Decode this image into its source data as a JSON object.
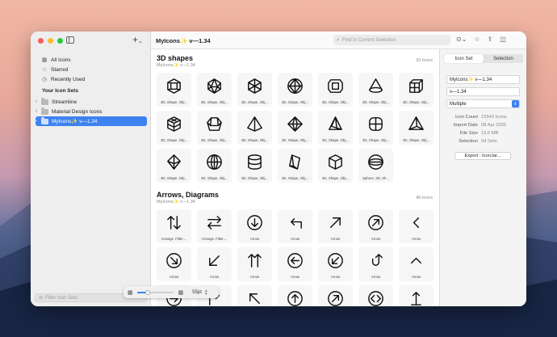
{
  "window": {
    "title": "MyIcons✨ v—1.34"
  },
  "sidebar": {
    "items": [
      {
        "label": "All Icons",
        "icon": "grid-icon"
      },
      {
        "label": "Starred",
        "icon": "star-icon"
      },
      {
        "label": "Recently Used",
        "icon": "clock-icon"
      }
    ],
    "section_label": "Your Icon Sets",
    "sets": [
      {
        "label": "Streamline",
        "selected": false
      },
      {
        "label": "Material Design Icons",
        "selected": false
      },
      {
        "label": "MyIcons✨ v—1.34",
        "selected": true
      }
    ],
    "filter_placeholder": "Filter Icon Sets"
  },
  "toolbar": {
    "search_placeholder": "Find in Current Selection"
  },
  "sections": [
    {
      "title": "3D shapes",
      "subtitle": "MyIcons✨ v—1.34",
      "count": "20 Icons",
      "icons": [
        {
          "label": "3D, Shape, Obj...",
          "shape": "cube-hex"
        },
        {
          "label": "3D, Shape, Obj...",
          "shape": "icosa"
        },
        {
          "label": "3D, Shape, Obj...",
          "shape": "hex-star"
        },
        {
          "label": "3D, Shape, Obj...",
          "shape": "octa"
        },
        {
          "label": "3D, Shape, Obj...",
          "shape": "prism"
        },
        {
          "label": "3D, Shape, Obj...",
          "shape": "cone"
        },
        {
          "label": "3D, Shape, Obj...",
          "shape": "cube-grid"
        },
        {
          "label": "3D, Shape, Obj...",
          "shape": "rubik"
        },
        {
          "label": "3D, Shape, Obj...",
          "shape": "frustum"
        },
        {
          "label": "3D, Shape, Obj...",
          "shape": "pyramid"
        },
        {
          "label": "3D, Shape, Obj...",
          "shape": "diamond-x"
        },
        {
          "label": "3D, Shape, Obj...",
          "shape": "pyramid2"
        },
        {
          "label": "3D, Shape, Obj...",
          "shape": "rounded-grid"
        },
        {
          "label": "3D, Shape, Obj...",
          "shape": "tetra"
        },
        {
          "label": "3D, Shape, Obj...",
          "shape": "bipyramid"
        },
        {
          "label": "3D, Shape, Obj...",
          "shape": "globe"
        },
        {
          "label": "3D, Shape, Obj...",
          "shape": "cylinder"
        },
        {
          "label": "3D, Shape, Obj...",
          "shape": "slab"
        },
        {
          "label": "3D, Shape, Obj...",
          "shape": "box"
        },
        {
          "label": "Sphere, 3D, Sh...",
          "shape": "sphere"
        }
      ]
    },
    {
      "title": "Arrows, Diagrams",
      "subtitle": "MyIcons✨ v—1.34",
      "count": "40 Icons",
      "icons": [
        {
          "label": "Arrange, Filter,...",
          "shape": "updown"
        },
        {
          "label": "Arrange, Filter,...",
          "shape": "leftright"
        },
        {
          "label": "Arrow",
          "shape": "circle-down"
        },
        {
          "label": "Arrow",
          "shape": "turn-up-left"
        },
        {
          "label": "Arrow",
          "shape": "diag-up-right"
        },
        {
          "label": "Arrow",
          "shape": "circle-up-right"
        },
        {
          "label": "Arrow",
          "shape": "chev-left"
        },
        {
          "label": "Arrow",
          "shape": "circle-down-right"
        },
        {
          "label": "Arrow",
          "shape": "diag-down-left"
        },
        {
          "label": "Arrow",
          "shape": "double-up"
        },
        {
          "label": "Arrow",
          "shape": "circle-left"
        },
        {
          "label": "Arrow",
          "shape": "circle-down-left"
        },
        {
          "label": "Arrow",
          "shape": "hook-up"
        },
        {
          "label": "Arrow",
          "shape": "chev-up"
        },
        {
          "label": "",
          "shape": "circle-right"
        },
        {
          "label": "",
          "shape": "turn-right-up"
        },
        {
          "label": "",
          "shape": "diag-up-left"
        },
        {
          "label": "",
          "shape": "circle-up"
        },
        {
          "label": "",
          "shape": "circle-up-right"
        },
        {
          "label": "",
          "shape": "circle-lr"
        },
        {
          "label": "",
          "shape": "bar-up"
        }
      ]
    }
  ],
  "zoom": {
    "value": "55pt",
    "level": 0.3
  },
  "inspector": {
    "tabs": [
      "Icon Set",
      "Selection"
    ],
    "active_tab": "Icon Set",
    "name_value": "MyIcons✨ v—1.34",
    "version_value": "v—1.34",
    "license_value": "Multiple",
    "stats": [
      {
        "key": "Icon Count",
        "value": "15542 Icons"
      },
      {
        "key": "Import Date",
        "value": "08 Apr 2025"
      },
      {
        "key": "File Size",
        "value": "15.6 MB"
      },
      {
        "key": "Selection",
        "value": "94 Sets"
      }
    ],
    "export_label": "Export : IconJar..."
  },
  "colors": {
    "accent": "#3d82f0",
    "close": "#fe5f57",
    "minimize": "#febc2e",
    "zoom": "#28c840"
  }
}
